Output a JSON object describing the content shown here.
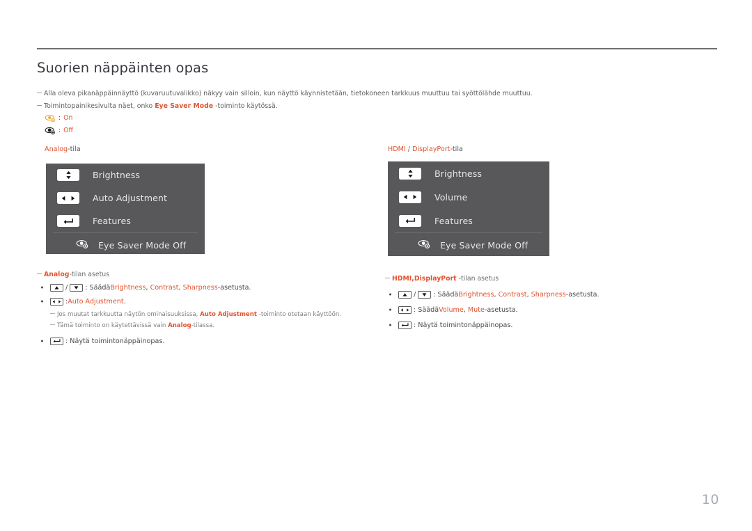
{
  "document": {
    "title": "Suorien näppäinten opas",
    "page_number": "10",
    "accent_color": "#e2532f",
    "panel_color": "#58585a",
    "rule_color": "#6e6e6e"
  },
  "intro": {
    "note1": "Alla oleva pikanäppäinnäyttö (kuvaruutuvalikko) näkyy vain silloin, kun näyttö käynnistetään, tietokoneen tarkkuus muuttuu tai syöttölähde muuttuu.",
    "note2_pre": "Toimintopainikesivulta näet, onko ",
    "note2_accent": "Eye Saver Mode",
    "note2_post": " -toiminto käytössä.",
    "legend": [
      {
        "icon": "eye-saver-on-icon",
        "separator": ":",
        "label": "On"
      },
      {
        "icon": "eye-saver-off-icon",
        "separator": ":",
        "label": "Off"
      }
    ]
  },
  "left_column": {
    "caption_accent": "Analog",
    "caption_rest": "-tila",
    "osd": {
      "rows": [
        {
          "key": "up-down-key-icon",
          "label": "Brightness"
        },
        {
          "key": "left-right-key-icon",
          "label": "Auto Adjustment"
        },
        {
          "key": "enter-key-icon",
          "label": "Features"
        }
      ],
      "footer": {
        "icon": "eye-saver-icon",
        "label": "Eye Saver Mode Off"
      }
    },
    "section_note_accent": "Analog",
    "section_note_rest": "-tilan asetus",
    "bullets": [
      {
        "keys": [
          "up-key-icon",
          "down-key-icon"
        ],
        "separator": "/",
        "text_pre": ": Säädä ",
        "accents": [
          "Brightness",
          "Contrast",
          "Sharpness"
        ],
        "text_post": "-asetusta."
      },
      {
        "keys": [
          "left-right-key-icon"
        ],
        "text_pre": ": ",
        "accents": [
          "Auto Adjustment"
        ],
        "text_post": "."
      },
      {
        "keys": [
          "enter-key-icon"
        ],
        "text_pre": ": Näytä toimintonäppäinopas.",
        "accents": [],
        "text_post": ""
      }
    ],
    "subnotes": [
      {
        "pre": "Jos muutat tarkkuutta näytön ominaisuuksissa, ",
        "accent": "Auto Adjustment",
        "post": " -toiminto otetaan käyttöön."
      },
      {
        "pre": "Tämä toiminto on käytettävissä vain ",
        "accent": "Analog",
        "post": "-tilassa."
      }
    ]
  },
  "right_column": {
    "caption_accent1": "HDMI",
    "caption_sep": " / ",
    "caption_accent2": "DisplayPort",
    "caption_rest": "-tila",
    "osd": {
      "rows": [
        {
          "key": "up-down-key-icon",
          "label": "Brightness"
        },
        {
          "key": "left-right-key-icon",
          "label": "Volume"
        },
        {
          "key": "enter-key-icon",
          "label": "Features"
        }
      ],
      "footer": {
        "icon": "eye-saver-icon",
        "label": "Eye Saver Mode Off"
      }
    },
    "section_note_accent": "HDMI,DisplayPort",
    "section_note_rest": " -tilan asetus",
    "bullets": [
      {
        "keys": [
          "up-key-icon",
          "down-key-icon"
        ],
        "separator": "/",
        "text_pre": ": Säädä ",
        "accents": [
          "Brightness",
          "Contrast",
          "Sharpness"
        ],
        "text_post": "-asetusta."
      },
      {
        "keys": [
          "left-right-key-icon"
        ],
        "text_pre": ": Säädä ",
        "accents": [
          "Volume",
          "Mute"
        ],
        "text_post": "-asetusta."
      },
      {
        "keys": [
          "enter-key-icon"
        ],
        "text_pre": ": Näytä toimintonäppäinopas.",
        "accents": [],
        "text_post": ""
      }
    ]
  }
}
